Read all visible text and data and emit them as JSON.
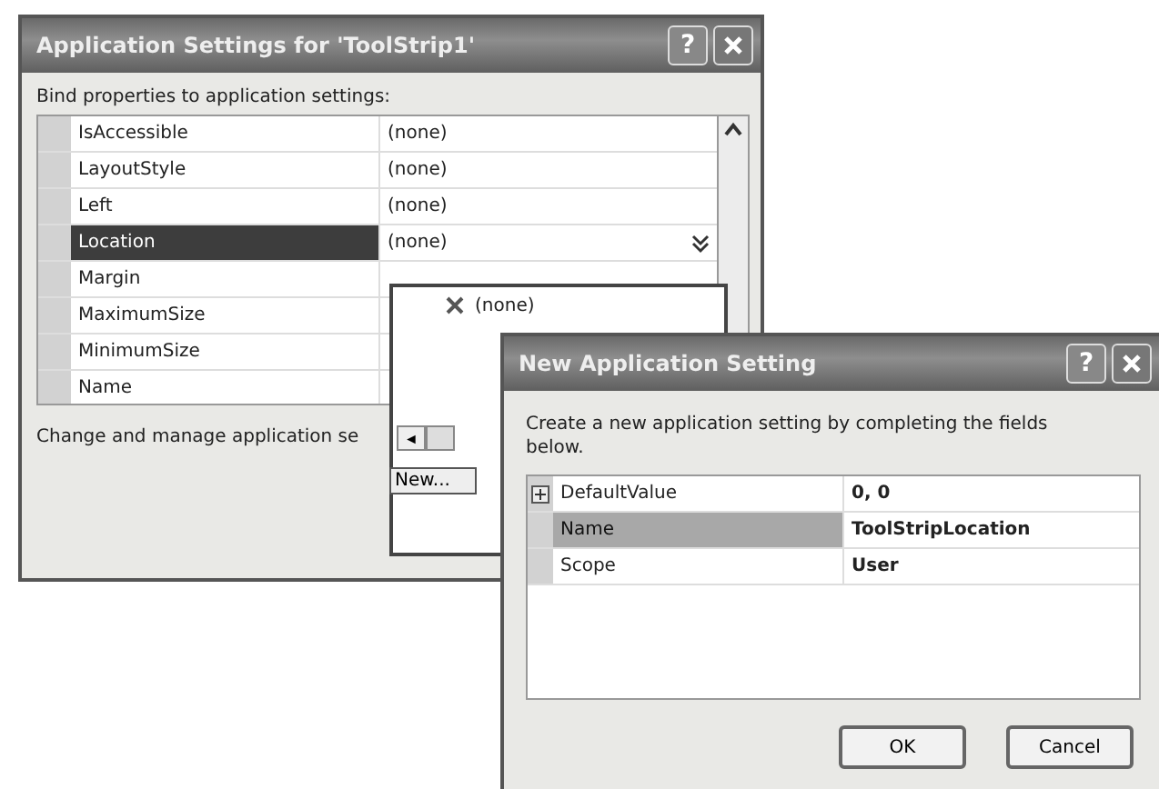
{
  "settings_dialog": {
    "title": "Application Settings for 'ToolStrip1'",
    "help_button": "?",
    "prompt": "Bind properties to application settings:",
    "properties": [
      {
        "name": "IsAccessible",
        "value": "(none)",
        "selected": false
      },
      {
        "name": "LayoutStyle",
        "value": "(none)",
        "selected": false
      },
      {
        "name": "Left",
        "value": "(none)",
        "selected": false
      },
      {
        "name": "Location",
        "value": "(none)",
        "selected": true
      },
      {
        "name": "Margin",
        "selected": false
      },
      {
        "name": "MaximumSize",
        "selected": false
      },
      {
        "name": "MinimumSize",
        "selected": false
      },
      {
        "name": "Name",
        "selected": false
      }
    ],
    "dropdown": {
      "items": [
        {
          "label": "(none)"
        }
      ],
      "scroll_arrow": "◄",
      "new_button": "New..."
    },
    "status": "Change and manage application se"
  },
  "new_setting_dialog": {
    "title": "New Application Setting",
    "help_button": "?",
    "description": "Create a new application setting by completing the fields below.",
    "fields": [
      {
        "name": "DefaultValue",
        "value": "0, 0",
        "selected": false,
        "expandable": true
      },
      {
        "name": "Name",
        "value": "ToolStripLocation",
        "selected": true,
        "expandable": false
      },
      {
        "name": "Scope",
        "value": "User",
        "selected": false,
        "expandable": false
      }
    ],
    "buttons": [
      {
        "label": "OK"
      },
      {
        "label": "Cancel"
      }
    ]
  }
}
